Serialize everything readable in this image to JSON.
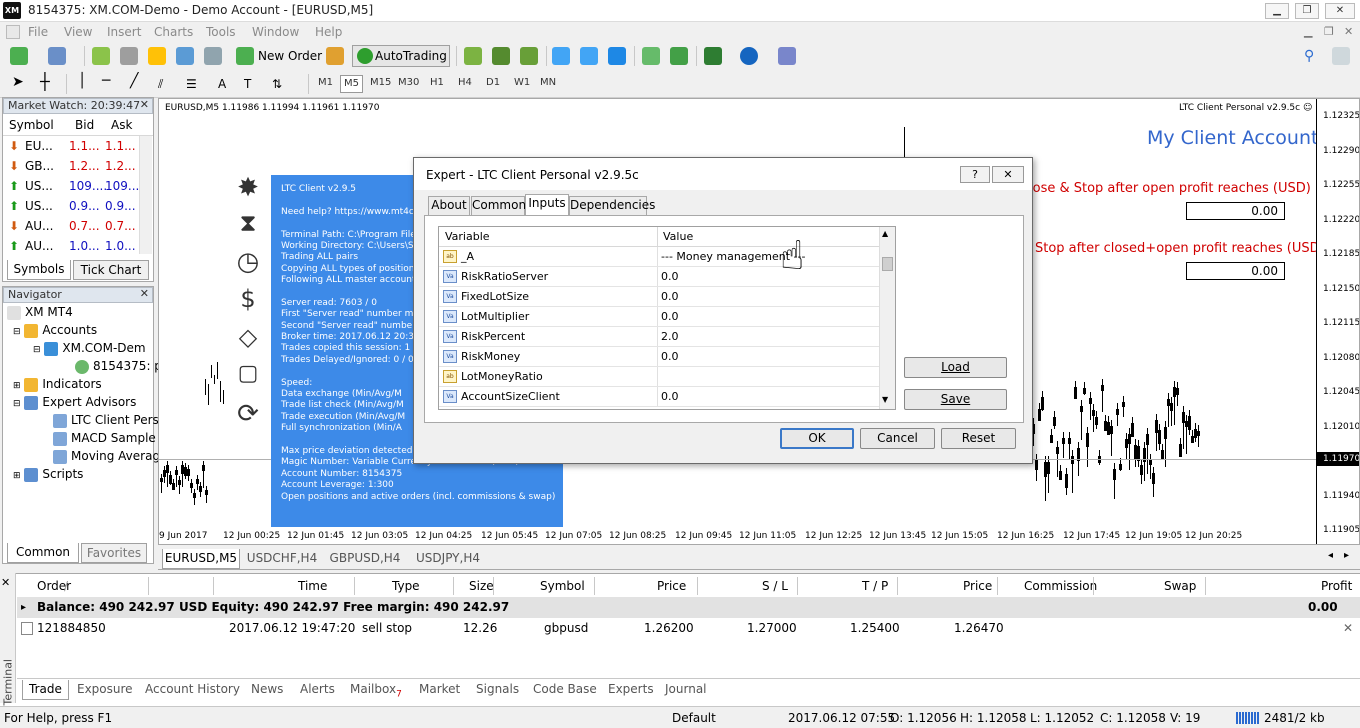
{
  "window": {
    "title": "8154375: XM.COM-Demo - Demo Account - [EURUSD,M5]",
    "logo": "XM"
  },
  "menu": [
    "File",
    "View",
    "Insert",
    "Charts",
    "Tools",
    "Window",
    "Help"
  ],
  "toolbar": {
    "new_order": "New Order",
    "autotrading": "AutoTrading",
    "timeframes": [
      "M1",
      "M5",
      "M15",
      "M30",
      "H1",
      "H4",
      "D1",
      "W1",
      "MN"
    ],
    "active_timeframe": "M5"
  },
  "market_watch": {
    "title": "Market Watch: 20:39:47",
    "headers": [
      "Symbol",
      "Bid",
      "Ask"
    ],
    "rows": [
      {
        "symbol": "EU...",
        "bid": "1.1...",
        "ask": "1.1...",
        "dir": "down"
      },
      {
        "symbol": "GB...",
        "bid": "1.2...",
        "ask": "1.2...",
        "dir": "down"
      },
      {
        "symbol": "US...",
        "bid": "109....",
        "ask": "109....",
        "dir": "up"
      },
      {
        "symbol": "US...",
        "bid": "0.9...",
        "ask": "0.9...",
        "dir": "up"
      },
      {
        "symbol": "AU...",
        "bid": "0.7...",
        "ask": "0.7...",
        "dir": "down"
      },
      {
        "symbol": "AU...",
        "bid": "1.0...",
        "ask": "1.0...",
        "dir": "up"
      }
    ],
    "tabs": [
      "Symbols",
      "Tick Chart"
    ]
  },
  "navigator": {
    "title": "Navigator",
    "items": [
      "XM MT4",
      "Accounts",
      "XM.COM-Dem",
      "8154375: pi",
      "Indicators",
      "Expert Advisors",
      "LTC Client Pers",
      "MACD Sample",
      "Moving Averag",
      "Scripts"
    ],
    "tabs": [
      "Common",
      "Favorites"
    ]
  },
  "chart": {
    "symbol_info": "EURUSD,M5  1.11986 1.11994 1.11961 1.11970",
    "ea_name": "LTC Client Personal v2.9.5c",
    "account_title": "My Client Account",
    "close_label1": "lose & Stop after open profit reaches (USD)",
    "value1": "0.00",
    "close_label2": "Stop after closed+open profit reaches (USD)",
    "value2": "0.00",
    "price_labels": [
      "1.12325",
      "1.12290",
      "1.12255",
      "1.12220",
      "1.12185",
      "1.12150",
      "1.12115",
      "1.12080",
      "1.12045",
      "1.12010",
      "1.11970",
      "1.11940",
      "1.11905"
    ],
    "current_price": "1.11970",
    "time_labels": [
      "9 Jun 2017",
      "12 Jun 00:25",
      "12 Jun 01:45",
      "12 Jun 03:05",
      "12 Jun 04:25",
      "12 Jun 05:45",
      "12 Jun 07:05",
      "12 Jun 08:25",
      "12 Jun 09:45",
      "12 Jun 11:05",
      "12 Jun 12:25",
      "12 Jun 13:45",
      "12 Jun 15:05",
      "12 Jun 16:25",
      "12 Jun 17:45",
      "12 Jun 19:05",
      "12 Jun 20:25"
    ],
    "tabs": [
      "EURUSD,M5",
      "USDCHF,H4",
      "GBPUSD,H4",
      "USDJPY,H4"
    ]
  },
  "info_panel": {
    "lines": [
      "LTC Client v2.9.5",
      "",
      "Need help? https://www.mt4co",
      "",
      "Terminal Path: C:\\Program File",
      "Working Directory: C:\\Users\\St",
      "Trading ALL pairs",
      "Copying ALL types of positions",
      "Following ALL master accounts",
      "",
      "Server read: 7603 / 0",
      "First \"Server read\" number me",
      "Second \"Server read\" number",
      "Broker time: 2017.06.12 20:39",
      "Trades copied this session: 1",
      "Trades Delayed/Ignored: 0 / 0",
      "",
      "Speed:",
      "     Data exchange (Min/Avg/M",
      "     Trade list check (Min/Avg/M",
      "     Trade execution (Min/Avg/M",
      "     Full synchronization (Min/A",
      "",
      "Max price deviation detected: 0.0 pips",
      "Magic Number: Variable     Currency suffix: None (auto)",
      "Account Number: 8154375",
      "Account Leverage: 1:300",
      "Open positions and active orders (incl. commissions & swap)"
    ]
  },
  "dialog": {
    "title": "Expert - LTC Client Personal v2.9.5c",
    "tabs": [
      "About",
      "Common",
      "Inputs",
      "Dependencies"
    ],
    "active_tab": "Inputs",
    "columns": [
      "Variable",
      "Value"
    ],
    "rows": [
      {
        "type": "ab",
        "name": "_A",
        "value": "--- Money management ---"
      },
      {
        "type": "Va",
        "name": "RiskRatioServer",
        "value": "0.0"
      },
      {
        "type": "Va",
        "name": "FixedLotSize",
        "value": "0.0"
      },
      {
        "type": "Va",
        "name": "LotMultiplier",
        "value": "0.0"
      },
      {
        "type": "Va",
        "name": "RiskPercent",
        "value": "2.0"
      },
      {
        "type": "Va",
        "name": "RiskMoney",
        "value": "0.0"
      },
      {
        "type": "ab",
        "name": "LotMoneyRatio",
        "value": ""
      },
      {
        "type": "Va",
        "name": "AccountSizeClient",
        "value": "0.0"
      }
    ],
    "buttons": {
      "load": "Load",
      "save": "Save",
      "ok": "OK",
      "cancel": "Cancel",
      "reset": "Reset"
    },
    "help": "?",
    "close": "✕"
  },
  "terminal": {
    "side_label": "Terminal",
    "columns": [
      "Order",
      "/",
      "Time",
      "Type",
      "Size",
      "Symbol",
      "Price",
      "S / L",
      "T / P",
      "Price",
      "Commission",
      "Swap",
      "Profit"
    ],
    "balance_line": "Balance: 490 242.97 USD  Equity: 490 242.97  Free margin: 490 242.97",
    "balance_profit": "0.00",
    "order": {
      "id": "121884850",
      "time": "2017.06.12 19:47:20",
      "type": "sell stop",
      "size": "12.26",
      "symbol": "gbpusd",
      "price": "1.26200",
      "sl": "1.27000",
      "tp": "1.25400",
      "cur_price": "1.26470"
    },
    "tabs": [
      "Trade",
      "Exposure",
      "Account History",
      "News",
      "Alerts",
      "Mailbox",
      "Market",
      "Signals",
      "Code Base",
      "Experts",
      "Journal"
    ],
    "mailbox_count": "7"
  },
  "status": {
    "help": "For Help, press F1",
    "profile": "Default",
    "datetime": "2017.06.12 07:55",
    "open": "O: 1.12056",
    "high": "H: 1.12058",
    "low": "L: 1.12052",
    "close": "C: 1.12058",
    "volume": "V: 19",
    "traffic": "2481/2 kb"
  },
  "colors": {
    "info_panel": "#3d8ae8",
    "account_title": "#3366cc",
    "close_label": "#d00000",
    "dialog_default_border": "#3a78c8"
  }
}
